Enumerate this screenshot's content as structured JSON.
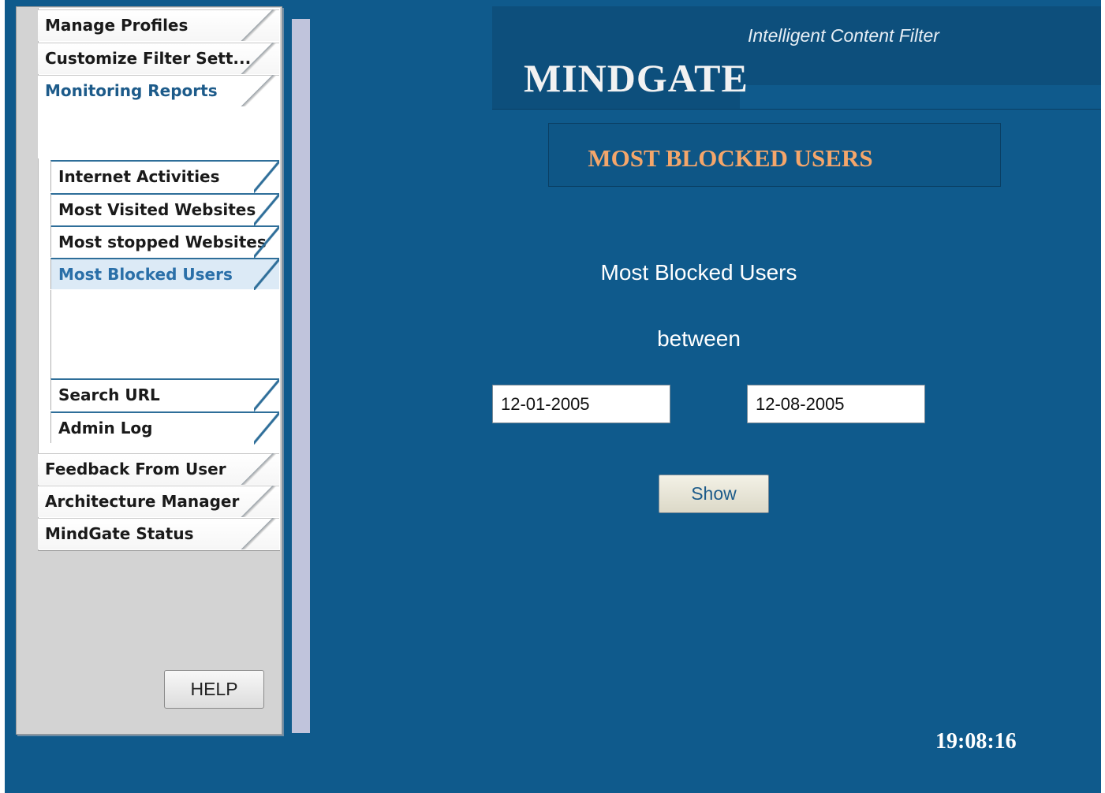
{
  "nav": {
    "tabs": [
      {
        "label": "Manage Profiles"
      },
      {
        "label": "Customize Filter Sett..."
      },
      {
        "label": "Monitoring Reports"
      },
      {
        "label": "Feedback From User"
      },
      {
        "label": "Architecture Manager"
      },
      {
        "label": "MindGate Status"
      }
    ],
    "active_tab": "Monitoring Reports",
    "subitems": [
      {
        "label": "Internet Activities"
      },
      {
        "label": "Most Visited Websites"
      },
      {
        "label": "Most stopped Websites"
      },
      {
        "label": "Most Blocked Users"
      },
      {
        "label": "Search URL"
      },
      {
        "label": "Admin Log"
      }
    ],
    "active_subitem": "Most Blocked Users"
  },
  "help_label": "HELP",
  "header": {
    "tagline": "Intelligent Content Filter",
    "logo": "MINDGATE"
  },
  "page_title": "MOST BLOCKED USERS",
  "form": {
    "title": "Most Blocked Users",
    "between_label": "between",
    "start_date": "12-01-2005",
    "end_date": "12-08-2005",
    "show_label": "Show"
  },
  "clock": "19:08:16",
  "colors": {
    "background": "#0f5a8c",
    "header": "#0d4f7c",
    "title_accent": "#f4a66b",
    "active_nav": "#1d5b8a"
  }
}
